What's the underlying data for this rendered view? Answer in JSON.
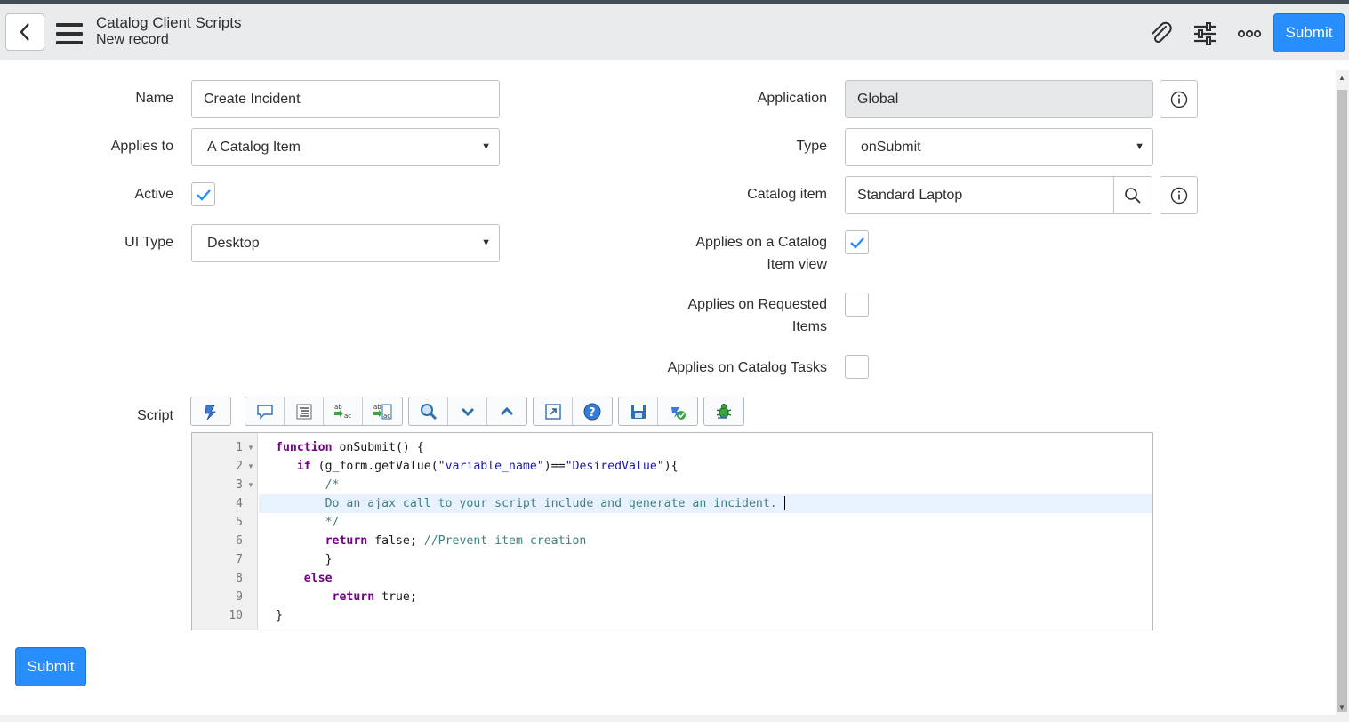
{
  "header": {
    "title": "Catalog Client Scripts",
    "subtitle": "New record",
    "submit_label": "Submit"
  },
  "icons": {
    "back": "chevron-left-icon",
    "menu": "hamburger-icon",
    "attach": "paperclip-icon",
    "personalize": "sliders-icon",
    "more": "more-options-icon",
    "info": "info-icon",
    "search": "search-icon",
    "check": "check-icon"
  },
  "form": {
    "name": {
      "label": "Name",
      "value": "Create Incident"
    },
    "applies_to": {
      "label": "Applies to",
      "value": "A Catalog Item"
    },
    "active": {
      "label": "Active",
      "checked": true
    },
    "ui_type": {
      "label": "UI Type",
      "value": "Desktop"
    },
    "application": {
      "label": "Application",
      "value": "Global"
    },
    "type": {
      "label": "Type",
      "value": "onSubmit"
    },
    "catalog_item": {
      "label": "Catalog item",
      "value": "Standard Laptop"
    },
    "applies_catalog_item_view": {
      "label_line1": "Applies on a Catalog",
      "label_line2": "Item view",
      "checked": true
    },
    "applies_requested_items": {
      "label_line1": "Applies on Requested",
      "label_line2": "Items",
      "checked": false
    },
    "applies_catalog_tasks": {
      "label": "Applies on Catalog Tasks",
      "checked": false
    },
    "script": {
      "label": "Script"
    }
  },
  "script_toolbar": [
    [
      "script-include-icon"
    ],
    [
      "comment-icon",
      "format-code-icon",
      "replace-icon",
      "replace-all-icon"
    ],
    [
      "search-icon",
      "search-next-icon",
      "search-previous-icon"
    ],
    [
      "fullscreen-icon",
      "help-icon"
    ],
    [
      "save-icon",
      "syntax-check-icon"
    ],
    [
      "debug-icon"
    ]
  ],
  "script_lines": [
    [
      {
        "t": "function",
        "c": "kw"
      },
      {
        "t": " onSubmit() {"
      }
    ],
    [
      {
        "t": "   "
      },
      {
        "t": "if",
        "c": "kw"
      },
      {
        "t": " (g_form.getValue("
      },
      {
        "t": "\"variable_name\"",
        "c": "str"
      },
      {
        "t": ")=="
      },
      {
        "t": "\"DesiredValue\"",
        "c": "str"
      },
      {
        "t": "){"
      }
    ],
    [
      {
        "t": "       "
      },
      {
        "t": "/*",
        "c": "cm"
      }
    ],
    [
      {
        "t": "       "
      },
      {
        "t": "Do an ajax call to your script include and generate an incident.",
        "c": "cm"
      }
    ],
    [
      {
        "t": "       "
      },
      {
        "t": "*/",
        "c": "cm"
      }
    ],
    [
      {
        "t": "       "
      },
      {
        "t": "return",
        "c": "kw"
      },
      {
        "t": " false; "
      },
      {
        "t": "//Prevent item creation",
        "c": "cm"
      }
    ],
    [
      {
        "t": "       }"
      }
    ],
    [
      {
        "t": "    "
      },
      {
        "t": "else",
        "c": "kw"
      }
    ],
    [
      {
        "t": "        "
      },
      {
        "t": "return",
        "c": "kw"
      },
      {
        "t": " true;"
      }
    ],
    [
      {
        "t": "}"
      }
    ]
  ],
  "line_numbers": [
    "1",
    "2",
    "3",
    "4",
    "5",
    "6",
    "7",
    "8",
    "9",
    "10"
  ],
  "active_line": 4,
  "footer": {
    "submit_label": "Submit"
  },
  "colors": {
    "primary": "#278efc",
    "header_bg": "#e9ebed",
    "check": "#278efc"
  }
}
